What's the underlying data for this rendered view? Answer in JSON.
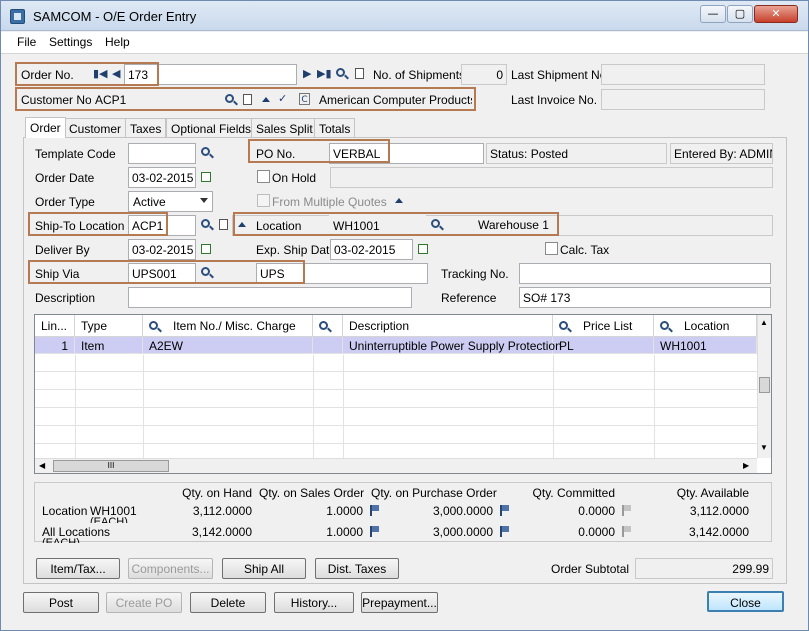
{
  "window": {
    "title": "SAMCOM - O/E Order Entry",
    "min": "—",
    "max": "▢",
    "close": "✕"
  },
  "menu": [
    "File",
    "Settings",
    "Help"
  ],
  "header": {
    "order_no_label": "Order No.",
    "order_no": "173",
    "shipments_label": "No. of Shipments",
    "shipments": "0",
    "last_shipment_label": "Last Shipment No.",
    "last_shipment": "",
    "customer_no_label": "Customer No.",
    "customer_no": "ACP1",
    "customer_name": "American Computer Products",
    "last_invoice_label": "Last Invoice No.",
    "last_invoice": ""
  },
  "tabs": [
    "Order",
    "Customer",
    "Taxes",
    "Optional Fields",
    "Sales Split",
    "Totals"
  ],
  "order": {
    "template_code_label": "Template Code",
    "template_code": "",
    "po_no_label": "PO No.",
    "po_no": "VERBAL",
    "status": "Status: Posted",
    "entered_by": "Entered By: ADMIN",
    "order_date_label": "Order Date",
    "order_date": "03-02-2015",
    "on_hold_label": "On Hold",
    "order_type_label": "Order Type",
    "order_type": "Active",
    "from_multiple_quotes_label": "From Multiple Quotes",
    "ship_to_label": "Ship-To Location",
    "ship_to": "ACP1",
    "location_label": "Location",
    "location": "WH1001",
    "location_name": "Warehouse 1",
    "deliver_by_label": "Deliver By",
    "deliver_by": "03-02-2015",
    "exp_ship_label": "Exp. Ship Date",
    "exp_ship": "03-02-2015",
    "calc_tax_label": "Calc. Tax",
    "ship_via_label": "Ship Via",
    "ship_via": "UPS001",
    "ship_via_name": "UPS",
    "tracking_label": "Tracking No.",
    "tracking": "",
    "description_label": "Description",
    "description": "",
    "reference_label": "Reference",
    "reference": "SO# 173"
  },
  "grid": {
    "columns": [
      "Lin...",
      "Type",
      "Item No./ Misc. Charge",
      "Description",
      "Price List",
      "Location"
    ],
    "rows": [
      {
        "line": "1",
        "type": "Item",
        "item": "A2EW",
        "description": "Uninterruptible Power Supply Protection",
        "price_list": "PL",
        "location": "WH1001"
      }
    ],
    "hscroll_grip": "III"
  },
  "quantities": {
    "headers": [
      "Qty. on Hand",
      "Qty. on Sales Order",
      "Qty. on Purchase Order",
      "Qty. Committed",
      "Qty. Available"
    ],
    "rows": [
      {
        "label": "Location",
        "sub": "WH1001",
        "unit": "(EACH)",
        "on_hand": "3,112.0000",
        "on_so": "1.0000",
        "on_po": "3,000.0000",
        "committed": "0.0000",
        "available": "3,112.0000"
      },
      {
        "label": "All Locations",
        "unit": "(EACH)",
        "on_hand": "3,142.0000",
        "on_so": "1.0000",
        "on_po": "3,000.0000",
        "committed": "0.0000",
        "available": "3,142.0000"
      }
    ]
  },
  "buttons_mid": [
    "Item/Tax...",
    "Components...",
    "Ship All",
    "Dist. Taxes"
  ],
  "subtotal_label": "Order Subtotal",
  "subtotal": "299.99",
  "buttons_bottom": [
    "Post",
    "Create PO",
    "Delete",
    "History...",
    "Prepayment...",
    "Close"
  ]
}
